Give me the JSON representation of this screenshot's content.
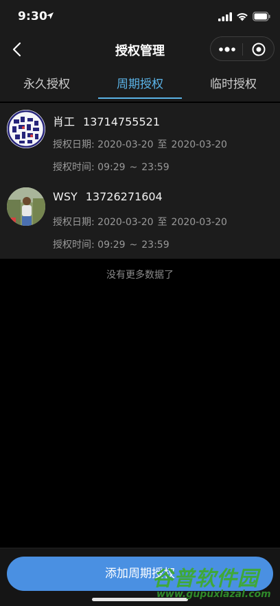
{
  "status": {
    "time": "9:30"
  },
  "nav": {
    "title": "授权管理"
  },
  "tabs": [
    {
      "label": "永久授权",
      "active": false
    },
    {
      "label": "周期授权",
      "active": true
    },
    {
      "label": "临时授权",
      "active": false
    }
  ],
  "records": [
    {
      "name": "肖工",
      "phone": "13714755521",
      "date_label": "授权日期:",
      "date_start": "2020-03-20",
      "date_sep": "至",
      "date_end": "2020-03-20",
      "time_label": "授权时间:",
      "time_start": "09:29",
      "time_sep": "~",
      "time_end": "23:59"
    },
    {
      "name": "WSY",
      "phone": "13726271604",
      "date_label": "授权日期:",
      "date_start": "2020-03-20",
      "date_sep": "至",
      "date_end": "2020-03-20",
      "time_label": "授权时间:",
      "time_start": "09:29",
      "time_sep": "~",
      "time_end": "23:59"
    }
  ],
  "list_footer": "没有更多数据了",
  "add_button": "添加周期授权",
  "watermark": {
    "title": "谷普软件园",
    "url": "www.gupuxlazal.com"
  },
  "colors": {
    "accent": "#5bb4e8",
    "button": "#4a90e2",
    "watermark": "#3fa83a"
  }
}
